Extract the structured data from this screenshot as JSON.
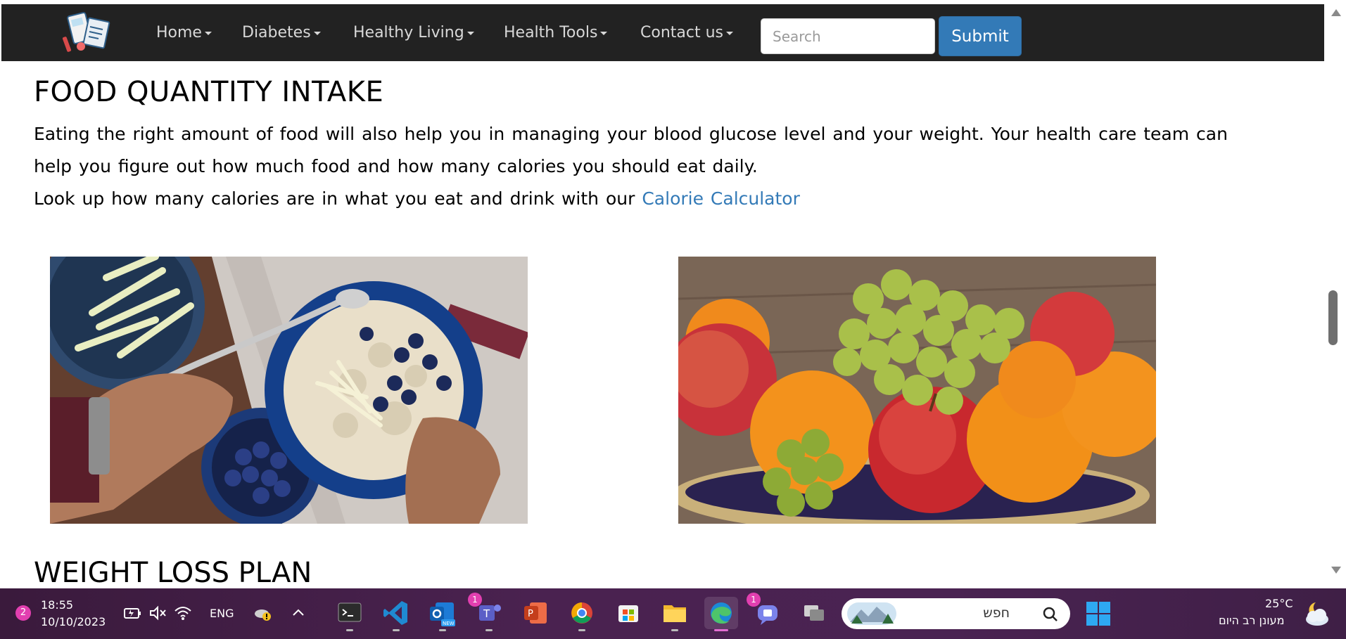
{
  "navbar": {
    "items": [
      {
        "label": "Home"
      },
      {
        "label": "Diabetes"
      },
      {
        "label": "Healthy Living"
      },
      {
        "label": "Health Tools"
      },
      {
        "label": "Contact us"
      }
    ],
    "search_placeholder": "Search",
    "submit_label": "Submit"
  },
  "content": {
    "section1_title": "FOOD QUANTITY INTAKE",
    "line1": "Eating the right amount of food will also help you in managing your blood glucose level and your weight. Your health care team can",
    "line2": "help you figure out how much food and how many calories you should eat daily.",
    "line3_prefix": "Look up how many calories are in what you eat and drink with our ",
    "calorie_link": "Calorie Calculator",
    "section2_title": "WEIGHT LOSS PLAN"
  },
  "taskbar": {
    "notification_count": "2",
    "time": "18:55",
    "date": "10/10/2023",
    "language": "ENG",
    "teams_badge": "1",
    "chat_badge": "1",
    "search_text": "חפש",
    "weather_temp": "25°C",
    "weather_desc": "מעונן רב היום",
    "apps": [
      "terminal-icon",
      "vscode-icon",
      "outlook-icon",
      "teams-icon",
      "powerpoint-icon",
      "chrome-icon",
      "store-icon",
      "file-explorer-icon",
      "edge-icon",
      "chat-icon",
      "task-view-icon"
    ]
  },
  "colors": {
    "navbar_bg": "#222222",
    "link": "#337ab7",
    "submit_bg": "#337ab7",
    "taskbar_bg": "#4a2250"
  }
}
